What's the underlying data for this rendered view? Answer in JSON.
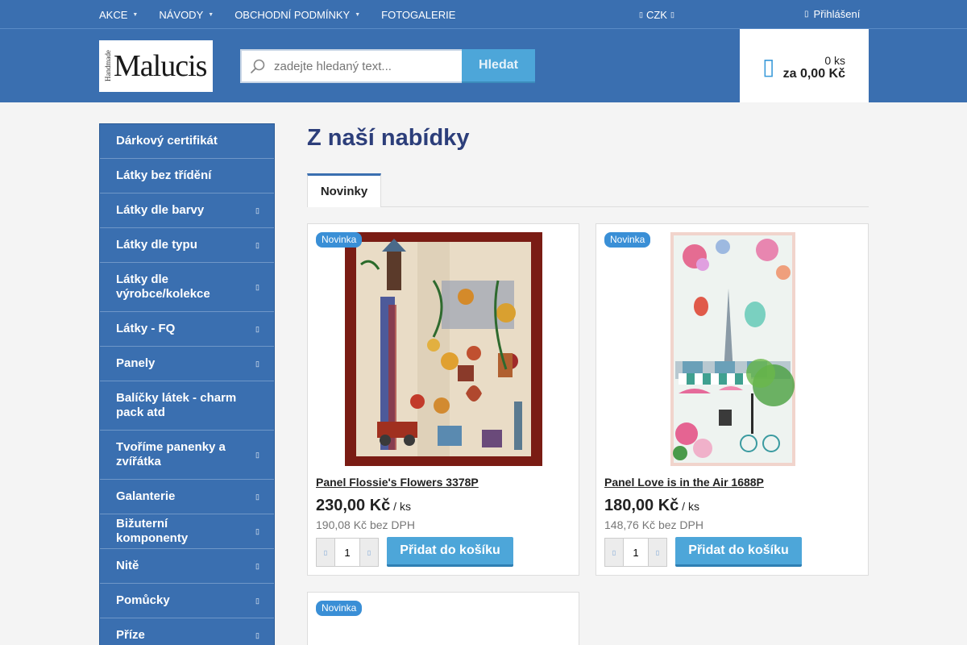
{
  "topnav": {
    "items": [
      {
        "label": "AKCE",
        "has_menu": true
      },
      {
        "label": "NÁVODY",
        "has_menu": true
      },
      {
        "label": "OBCHODNÍ PODMÍNKY",
        "has_menu": true
      },
      {
        "label": "FOTOGALERIE",
        "has_menu": false
      }
    ],
    "currency": "CZK",
    "login": "Přihlášení"
  },
  "header": {
    "logo": {
      "small": "Handmade",
      "name": "Malucis"
    },
    "search": {
      "placeholder": "zadejte hledaný text...",
      "button": "Hledat"
    },
    "cart": {
      "count": "0 ks",
      "total": "za 0,00 Kč"
    }
  },
  "sidebar": {
    "categories": [
      {
        "label": "Dárkový certifikát",
        "arrow": false
      },
      {
        "label": "Látky bez třídění",
        "arrow": false
      },
      {
        "label": "Látky dle barvy",
        "arrow": true
      },
      {
        "label": "Látky dle typu",
        "arrow": true
      },
      {
        "label": "Látky dle výrobce/kolekce",
        "arrow": true
      },
      {
        "label": "Látky - FQ",
        "arrow": true
      },
      {
        "label": "Panely",
        "arrow": true
      },
      {
        "label": "Balíčky látek - charm pack atd",
        "arrow": false
      },
      {
        "label": "Tvoříme panenky a zvířátka",
        "arrow": true
      },
      {
        "label": "Galanterie",
        "arrow": true
      },
      {
        "label": "Bižuterní komponenty",
        "arrow": true
      },
      {
        "label": "Nitě",
        "arrow": true
      },
      {
        "label": "Pomůcky",
        "arrow": true
      },
      {
        "label": "Příze",
        "arrow": true
      }
    ]
  },
  "main": {
    "title": "Z naší nabídky",
    "tabs": [
      {
        "label": "Novinky",
        "active": true
      }
    ],
    "products": [
      {
        "badge": "Novinka",
        "name": "Panel Flossie's Flowers 3378P",
        "price": "230,00 Kč",
        "unit": " / ks",
        "price_no_vat": "190,08 Kč bez DPH",
        "qty": "1",
        "button": "Přidat do košíku"
      },
      {
        "badge": "Novinka",
        "name": "Panel Love is in the Air 1688P",
        "price": "180,00 Kč",
        "unit": " / ks",
        "price_no_vat": "148,76 Kč bez DPH",
        "qty": "1",
        "button": "Přidat do košíku"
      },
      {
        "badge": "Novinka"
      }
    ]
  },
  "colors": {
    "brand_blue": "#3a6fb0",
    "accent": "#4da6d9",
    "title": "#2c3e7a"
  }
}
